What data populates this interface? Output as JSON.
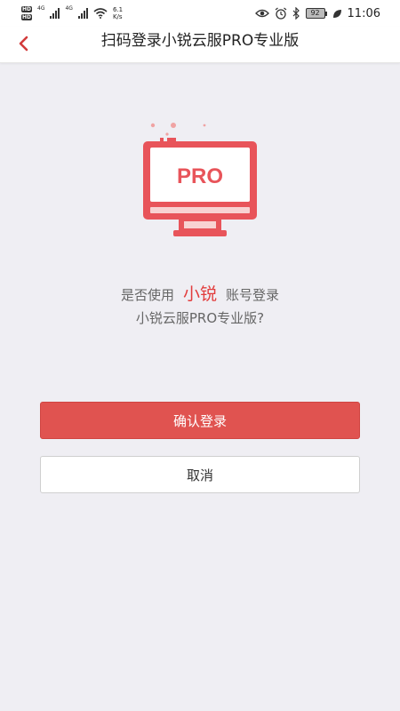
{
  "status_bar": {
    "hd_1": "HD",
    "hd_2": "HD",
    "net_type_1": "4G",
    "net_type_2": "4G",
    "speed_value": "6.1",
    "speed_unit": "K/s",
    "battery": "92",
    "time": "11:06",
    "icons": [
      "eye-icon",
      "alarm-icon",
      "bluetooth-icon",
      "battery-icon",
      "leaf-icon"
    ]
  },
  "header": {
    "title": "扫码登录小锐云服PRO专业版",
    "back_icon": "chevron-left-icon"
  },
  "illustration": {
    "label": "PRO",
    "icon": "monitor-icon",
    "accent_color": "#e8545a"
  },
  "prompt": {
    "prefix": "是否使用",
    "account_name": "小锐",
    "suffix": "账号登录",
    "line2": "小锐云服PRO专业版?"
  },
  "actions": {
    "confirm_label": "确认登录",
    "cancel_label": "取消"
  },
  "colors": {
    "accent": "#e05350",
    "background": "#efeef3"
  }
}
